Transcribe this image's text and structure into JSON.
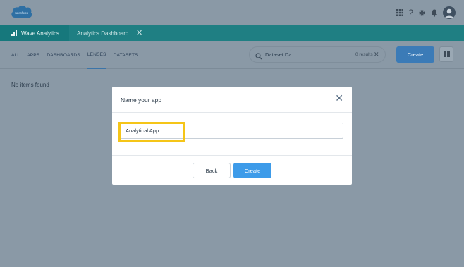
{
  "header": {
    "logo_text": "salesforce",
    "icons": [
      "app-launcher-icon",
      "help-icon",
      "setup-gear-icon",
      "notifications-bell-icon",
      "user-avatar-icon"
    ],
    "help_glyph": "?"
  },
  "appbar": {
    "app_name": "Wave Analytics",
    "tab_label": "Analytics Dashboard",
    "tab_close": "✕"
  },
  "subnav": {
    "tabs": [
      "ALL",
      "APPS",
      "DASHBOARDS",
      "LENSES",
      "DATASETS"
    ],
    "active_tab": "LENSES"
  },
  "search": {
    "value": "Dataset Da",
    "results": "0 results",
    "clear": "✕"
  },
  "toolbar": {
    "create_label": "Create"
  },
  "main": {
    "empty_message": "No items found"
  },
  "modal": {
    "title": "Name your app",
    "close": "✕",
    "input_value": "Analytical App",
    "back_label": "Back",
    "create_label": "Create"
  },
  "colors": {
    "appbar": "#1f7f83",
    "primary_button": "#3d9be9",
    "highlight": "#f5c518",
    "overlay": "#8a99a6"
  }
}
